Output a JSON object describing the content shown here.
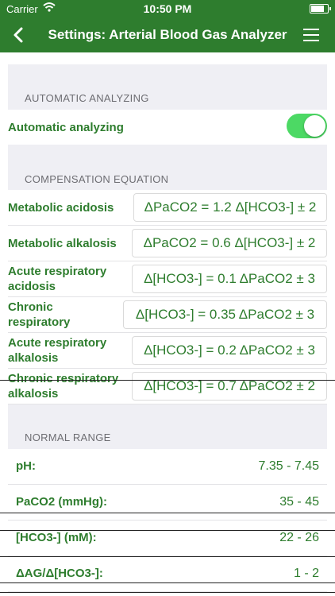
{
  "status": {
    "carrier": "Carrier",
    "time": "10:50 PM"
  },
  "nav": {
    "title": "Settings: Arterial Blood Gas Analyzer"
  },
  "sections": {
    "auto": "AUTOMATIC ANALYZING",
    "comp": "COMPENSATION EQUATION",
    "normal": "NORMAL RANGE"
  },
  "auto": {
    "label": "Automatic analyzing",
    "enabled": true
  },
  "equations": [
    {
      "label": "Metabolic acidosis",
      "eq": "ΔPaCO2 = 1.2 Δ[HCO3-] ± 2"
    },
    {
      "label": "Metabolic alkalosis",
      "eq": "ΔPaCO2 = 0.6 Δ[HCO3-] ± 2"
    },
    {
      "label": "Acute respiratory acidosis",
      "eq": "Δ[HCO3-] = 0.1 ΔPaCO2 ± 3"
    },
    {
      "label": "Chronic respiratory",
      "eq": "Δ[HCO3-] = 0.35 ΔPaCO2 ± 3"
    },
    {
      "label": "Acute respiratory alkalosis",
      "eq": "Δ[HCO3-] = 0.2 ΔPaCO2 ± 3"
    },
    {
      "label": "Chronic respiratory alkalosis",
      "eq": "Δ[HCO3-] = 0.7 ΔPaCO2 ± 2"
    }
  ],
  "normal_ranges": [
    {
      "label": "pH:",
      "value": "7.35  -  7.45"
    },
    {
      "label": "PaCO2 (mmHg):",
      "value": "35  -  45"
    },
    {
      "label": "[HCO3-] (mM):",
      "value": "22  -  26"
    },
    {
      "label": "ΔAG/Δ[HCO3-]:",
      "value": "1  -  2"
    }
  ],
  "colors": {
    "accent": "#2e7d2e",
    "toggle_on": "#4cd964",
    "group_bg": "#efeff4"
  }
}
